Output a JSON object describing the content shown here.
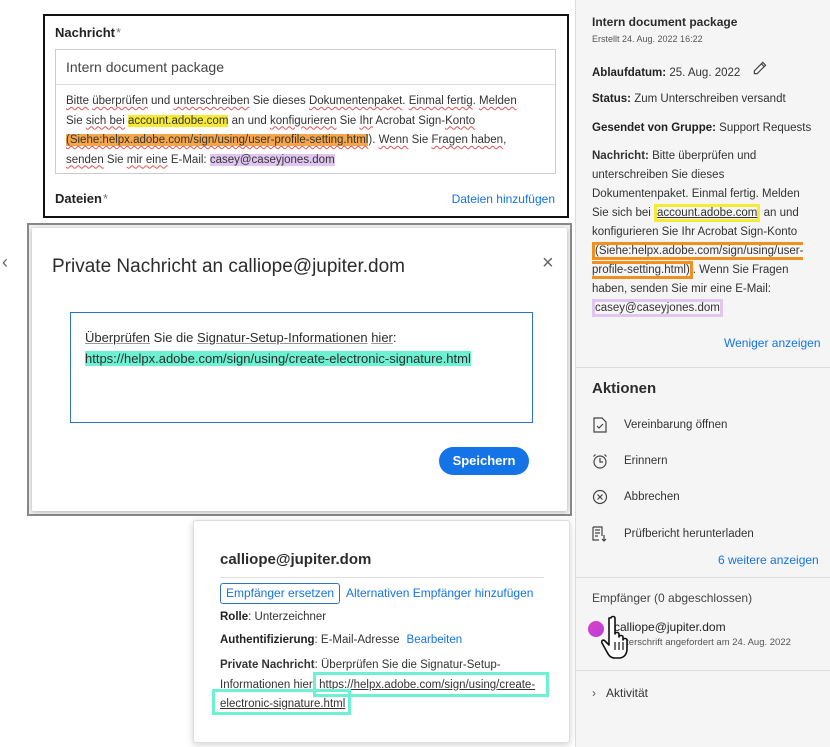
{
  "message_card": {
    "label": "Nachricht",
    "required_mark": "*",
    "subject": "Intern document package",
    "body_line1_parts": [
      "Bitte",
      " ",
      "überprüfen",
      " und ",
      "unterschreiben",
      " Sie dieses ",
      "Dokumentenpaket",
      ". ",
      "Einmal fertig",
      ". ",
      "Melden"
    ],
    "body_line2_a": "Sie ",
    "body_line2_b": "sich bei",
    "body_line2_c": " ",
    "body_line2_link": "account.adobe.com",
    "body_line2_d": " an und ",
    "body_line2_e": "konfigurieren",
    "body_line2_f": " Sie ",
    "body_line2_g": "Ihr",
    "body_line2_h": " Acrobat Sign-",
    "body_line2_i": "Konto",
    "body_line3_link": "(Siehe:helpx.adobe.com/sign/using/user-profile-setting.html",
    "body_line3_a": "). ",
    "body_line3_b": "Wenn",
    "body_line3_c": " Sie ",
    "body_line3_d": "Fragen haben",
    "body_line3_e": ",",
    "body_line4_a": "senden",
    "body_line4_b": " Sie ",
    "body_line4_c": "mir eine",
    "body_line4_d": " E-Mail: ",
    "body_line4_email": "casey@caseyjones.dom",
    "files_label": "Dateien",
    "files_add": "Dateien hinzufügen"
  },
  "modal": {
    "title": "Private Nachricht an calliope@jupiter.dom",
    "close_glyph": "×",
    "text_a": "Überprüfen",
    "text_b": " Sie die ",
    "text_c": "Signatur-Setup-Informationen",
    "text_d": " ",
    "text_e": "hier",
    "text_f": ":",
    "text_url": "https://helpx.adobe.com/sign/using/create-electronic-signature.html",
    "save_label": "Speichern"
  },
  "popover": {
    "email": "calliope@jupiter.dom",
    "replace_label": "Empfänger ersetzen",
    "alt_label": "Alternativen Empfänger hinzufügen",
    "role_label": "Rolle",
    "role_value": ": Unterzeichner",
    "auth_label": "Authentifizierung",
    "auth_value": ": E-Mail-Adresse",
    "auth_edit": "Bearbeiten",
    "private_label": "Private Nachricht",
    "private_text": ": Überprüfen Sie die Signatur-Setup-Informationen hier: ",
    "private_url": "https://helpx.adobe.com/sign/using/create-electronic-signature.html"
  },
  "sidebar": {
    "title": "Intern document package",
    "created": "Erstellt 24. Aug. 2022 16:22",
    "expiry_label": "Ablaufdatum:",
    "expiry_value": "25. Aug. 2022",
    "status_label": "Status:",
    "status_value": "Zum Unterschreiben versandt",
    "group_label": "Gesendet von Gruppe:",
    "group_value": "Support Requests",
    "message_label": "Nachricht:",
    "message_a": "Bitte überprüfen und unterschreiben Sie dieses Dokumentenpaket. Einmal fertig. Melden Sie sich bei ",
    "message_link1": "account.adobe.com",
    "message_b": " an und konfigurieren Sie Ihr Acrobat Sign-Konto ",
    "message_link2": "(Siehe:helpx.adobe.com/sign/using/user-profile-setting.html)",
    "message_c": ". Wenn Sie Fragen haben, senden Sie mir eine E-Mail: ",
    "message_email": "casey@caseyjones.dom",
    "show_less": "Weniger anzeigen",
    "actions_heading": "Aktionen",
    "actions": [
      {
        "label": "Vereinbarung öffnen",
        "icon": "document-check-icon"
      },
      {
        "label": "Erinnern",
        "icon": "alarm-clock-icon"
      },
      {
        "label": "Abbrechen",
        "icon": "cancel-circle-icon"
      },
      {
        "label": "Prüfbericht herunterladen",
        "icon": "report-download-icon"
      }
    ],
    "more_label": "6 weitere anzeigen",
    "recipients_heading": "Empfänger (0 abgeschlossen)",
    "recipient_name": "calliope@jupiter.dom",
    "recipient_status": "Unterschrift angefordert am 24. Aug. 2022",
    "activity_label": "Aktivität"
  },
  "colors": {
    "accent": "#1473e6",
    "highlight_yellow": "#f7ea34",
    "highlight_orange": "#f5a64a",
    "highlight_purple": "#e2c6f2",
    "highlight_teal": "#6ef0d2"
  }
}
